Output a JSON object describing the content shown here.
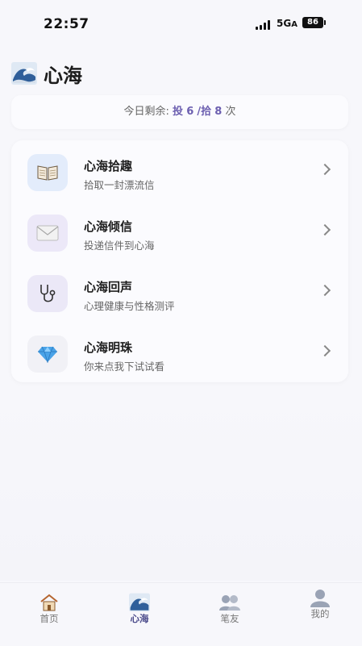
{
  "status_bar": {
    "time": "22:57",
    "network": "5G",
    "network_suffix": "A",
    "battery": "86"
  },
  "header": {
    "title": "心海",
    "icon": "wave-icon"
  },
  "quota": {
    "prefix": "今日剩余:",
    "toss_label": "投",
    "toss_count": "6",
    "separator": "/",
    "pick_label": "拾",
    "pick_count": "8",
    "suffix": "次"
  },
  "menu": {
    "items": [
      {
        "title": "心海拾趣",
        "subtitle": "拾取一封漂流信",
        "icon": "book-icon",
        "icon_bg": "#e3ecfb"
      },
      {
        "title": "心海倾信",
        "subtitle": "投递信件到心海",
        "icon": "envelope-icon",
        "icon_bg": "#ece8f8"
      },
      {
        "title": "心海回声",
        "subtitle": "心理健康与性格测评",
        "icon": "stethoscope-icon",
        "icon_bg": "#ebe8f7"
      },
      {
        "title": "心海明珠",
        "subtitle": "你来点我下试试看",
        "icon": "gem-icon",
        "icon_bg": "#f1f1f6"
      }
    ]
  },
  "tabs": [
    {
      "label": "首页",
      "icon": "house-icon",
      "active": false
    },
    {
      "label": "心海",
      "icon": "wave-icon",
      "active": true
    },
    {
      "label": "笔友",
      "icon": "friends-icon",
      "active": false
    },
    {
      "label": "我的",
      "icon": "profile-icon",
      "active": false
    }
  ],
  "colors": {
    "accent": "#6c5fb0",
    "background": "#f7f7fb"
  }
}
